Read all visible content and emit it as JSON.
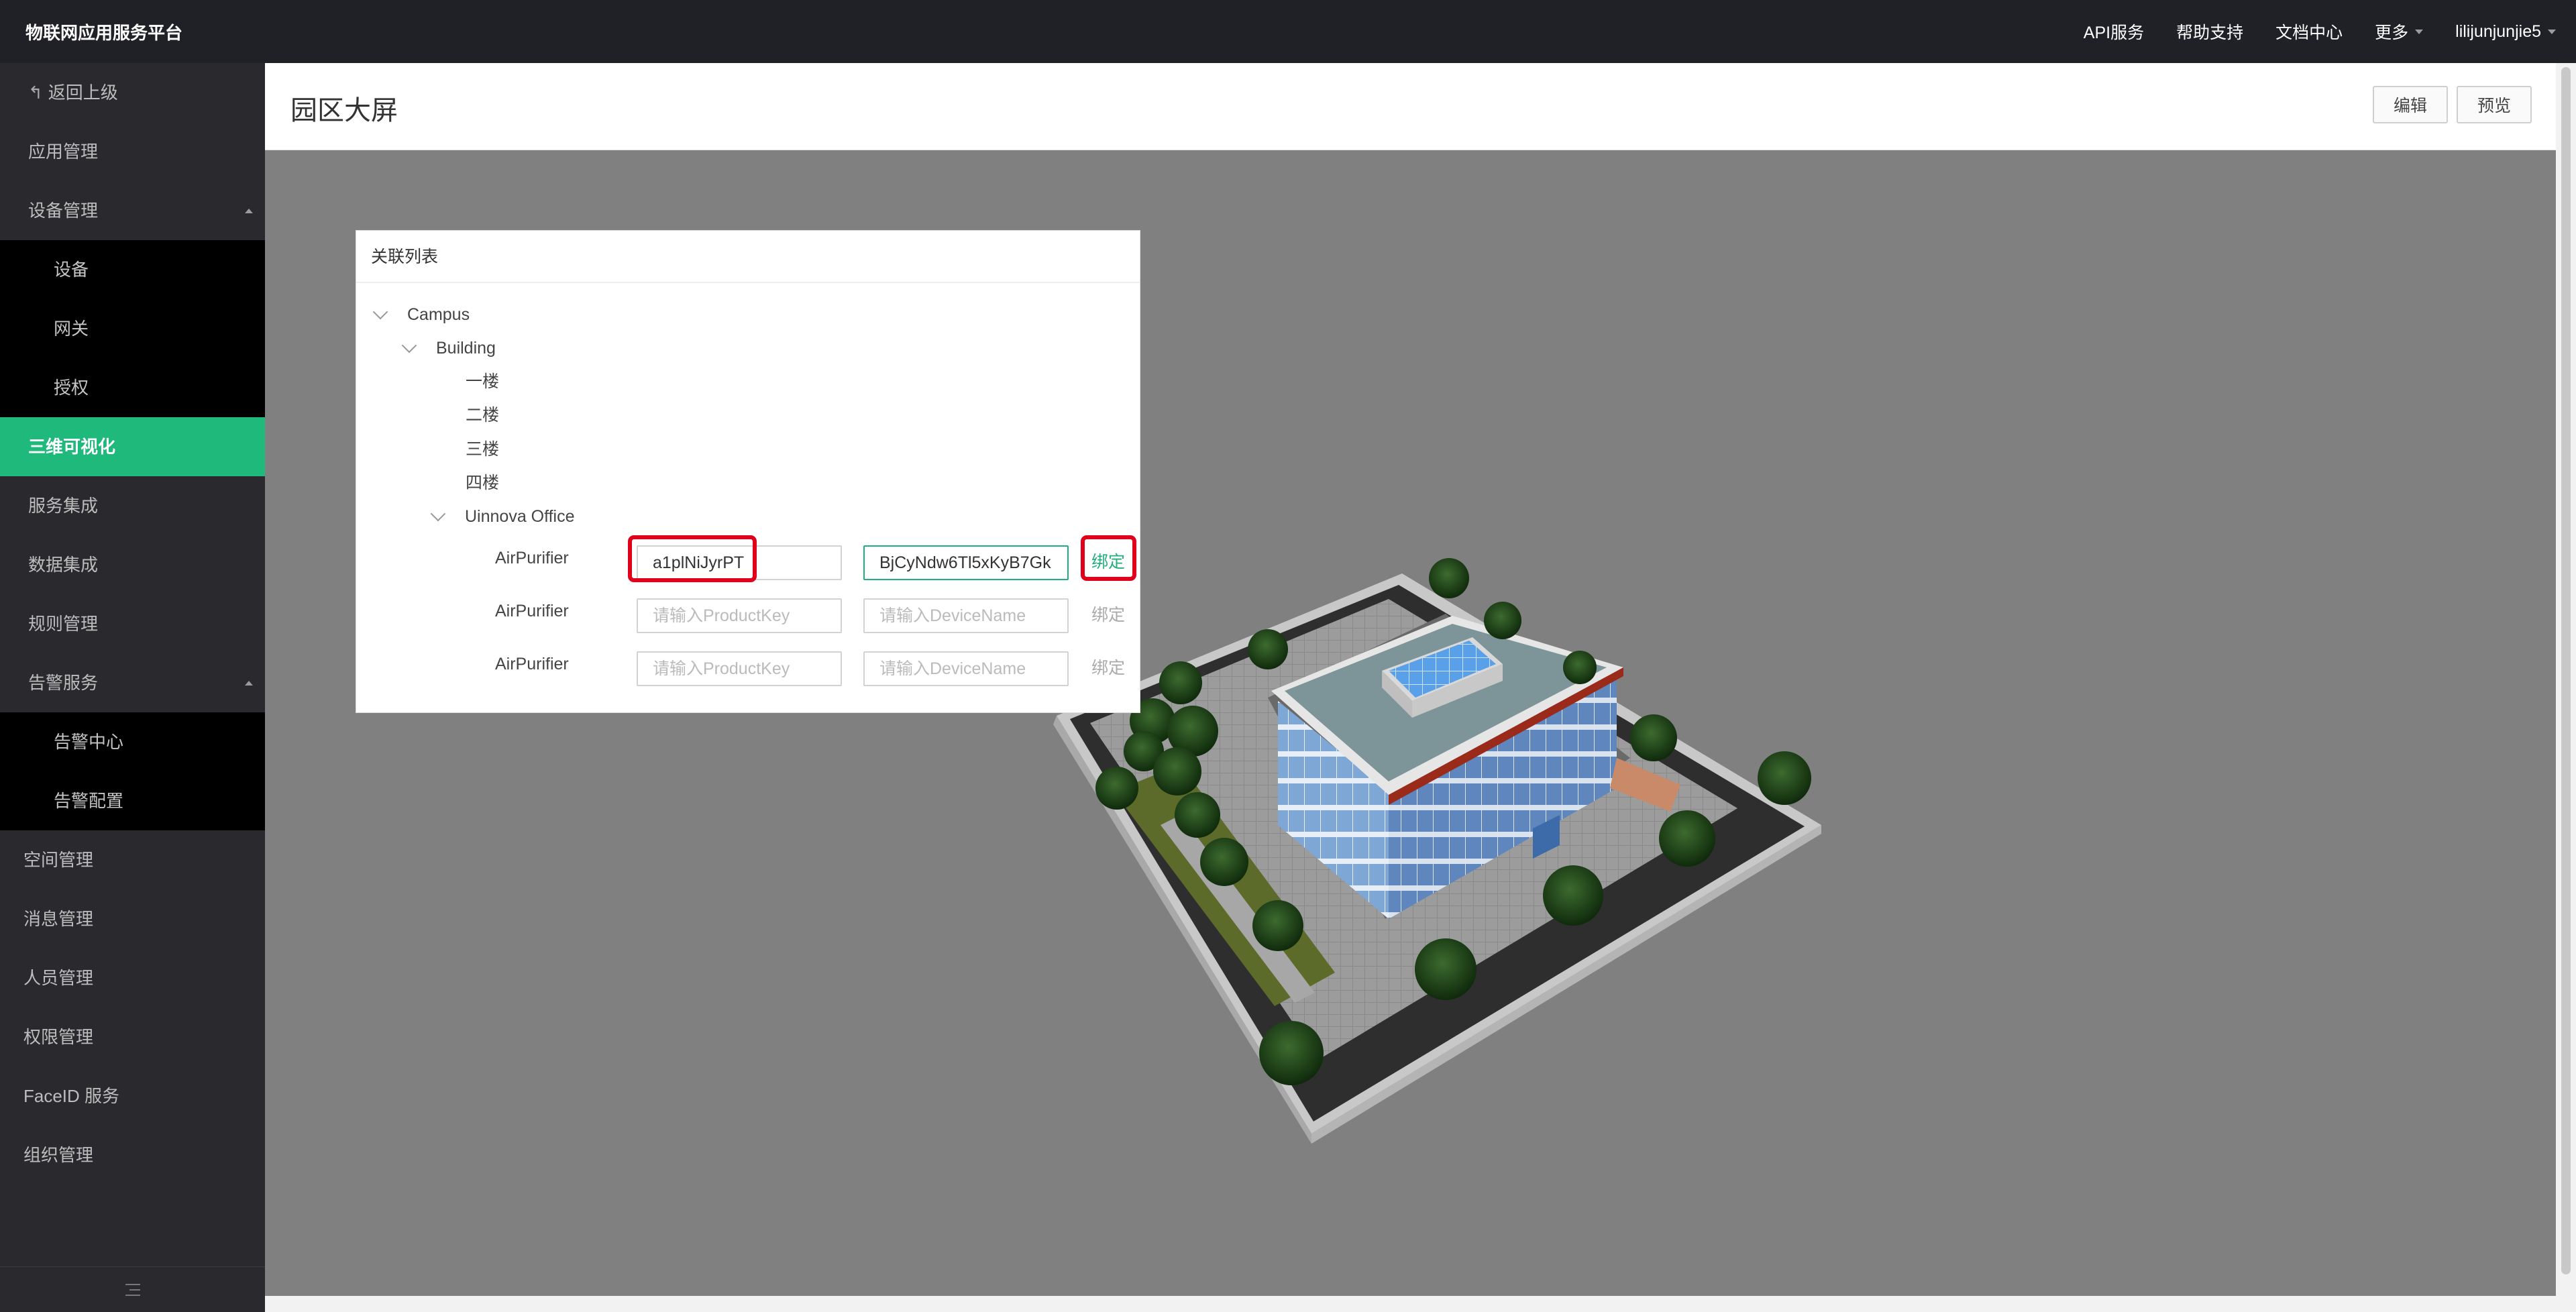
{
  "app": {
    "title": "物联网应用服务平台"
  },
  "topnav": [
    {
      "label": "API服务",
      "caret": false
    },
    {
      "label": "帮助支持",
      "caret": false
    },
    {
      "label": "文档中心",
      "caret": false
    },
    {
      "label": "更多",
      "caret": true
    },
    {
      "label": "lilijunjunjie5",
      "caret": true
    }
  ],
  "sidebar": {
    "back": "返回上级",
    "items": [
      {
        "label": "应用管理"
      },
      {
        "label": "设备管理"
      },
      {
        "label": "设备"
      },
      {
        "label": "网关"
      },
      {
        "label": "授权"
      },
      {
        "label": "三维可视化"
      },
      {
        "label": "服务集成"
      },
      {
        "label": "数据集成"
      },
      {
        "label": "规则管理"
      },
      {
        "label": "告警服务"
      },
      {
        "label": "告警中心"
      },
      {
        "label": "告警配置"
      },
      {
        "label": "空间管理"
      },
      {
        "label": "消息管理"
      },
      {
        "label": "人员管理"
      },
      {
        "label": "权限管理"
      },
      {
        "label": "FaceID 服务"
      },
      {
        "label": "组织管理"
      }
    ]
  },
  "header": {
    "title": "园区大屏",
    "edit": "编辑",
    "preview": "预览"
  },
  "panel": {
    "title": "关联列表",
    "tree": {
      "campus": "Campus",
      "building": "Building",
      "floors": [
        "一楼",
        "二楼",
        "三楼",
        "四楼"
      ],
      "office": "Uinnova Office"
    },
    "devices": [
      {
        "name": "AirPurifier",
        "product_key": "a1plNiJyrPT",
        "device_name": "BjCyNdw6Tl5xKyB7Gk",
        "bind": "绑定"
      },
      {
        "name": "AirPurifier",
        "product_key": "",
        "device_name": "",
        "bind": "绑定"
      },
      {
        "name": "AirPurifier",
        "product_key": "",
        "device_name": "",
        "bind": "绑定"
      }
    ],
    "placeholders": {
      "product_key": "请输入ProductKey",
      "device_name": "请输入DeviceName"
    }
  },
  "colors": {
    "accent": "#1fb97c",
    "topbar": "#202027",
    "sidebar": "#2a2a2e",
    "highlight": "#e0001a"
  }
}
